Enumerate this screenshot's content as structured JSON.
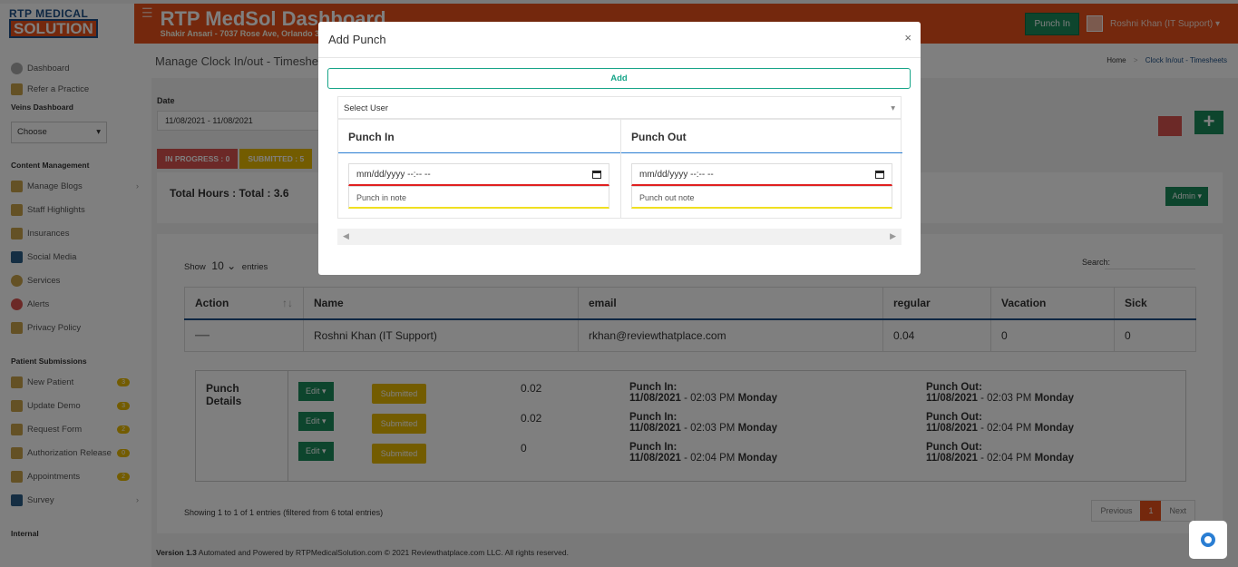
{
  "app": {
    "logo_line1": "RTP MEDICAL",
    "logo_line2": "SOLUTION",
    "title": "RTP MedSol Dashboard",
    "subtitle": "Shakir Ansari - 7037 Rose Ave, Orlando 3",
    "punch_in_button": "Punch In",
    "user_name": "Roshni Khan (IT Support)"
  },
  "sidebar": {
    "top_items": [
      {
        "label": "Dashboard",
        "icon": "clock-icon"
      },
      {
        "label": "Refer a Practice",
        "icon": "refer-icon"
      }
    ],
    "veins_heading": "Veins Dashboard",
    "choose_select": "Choose",
    "content_heading": "Content Management",
    "content_items": [
      {
        "label": "Manage Blogs",
        "icon": "blog-icon",
        "chevron": true
      },
      {
        "label": "Staff Highlights",
        "icon": "staff-icon"
      },
      {
        "label": "Insurances",
        "icon": "insurance-icon"
      },
      {
        "label": "Social Media",
        "icon": "social-icon"
      },
      {
        "label": "Services",
        "icon": "services-icon"
      },
      {
        "label": "Alerts",
        "icon": "alert-icon"
      },
      {
        "label": "Privacy Policy",
        "icon": "privacy-icon"
      }
    ],
    "patient_heading": "Patient Submissions",
    "patient_items": [
      {
        "label": "New Patient",
        "icon": "patient-icon",
        "badge": "3"
      },
      {
        "label": "Update Demo",
        "icon": "update-icon",
        "badge": "3"
      },
      {
        "label": "Request Form",
        "icon": "request-icon",
        "badge": "2"
      },
      {
        "label": "Authorization Release",
        "icon": "auth-icon",
        "badge": "0"
      },
      {
        "label": "Appointments",
        "icon": "calendar-icon",
        "badge": "2"
      },
      {
        "label": "Survey",
        "icon": "survey-icon",
        "chevron": true
      }
    ],
    "internal_heading": "Internal"
  },
  "page": {
    "heading": "Manage Clock In/out - Timeshe",
    "breadcrumb_home": "Home",
    "breadcrumb_sep": ">",
    "breadcrumb_active": "Clock In/out - Timesheets",
    "date_label": "Date",
    "date_value": "11/08/2021 - 11/08/2021",
    "status_pills": [
      {
        "label": "IN PROGRESS : 0",
        "color": "#d9534f"
      },
      {
        "label": "SUBMITTED : 5",
        "color": "#e6b800"
      }
    ],
    "total_hours": "Total Hours : Total : 3.6",
    "admin_button": "Admin",
    "plus_button": "+"
  },
  "table": {
    "show_label": "Show",
    "show_value": "10",
    "entries_label": "entries",
    "search_label": "Search:",
    "headers": [
      "Action",
      "Name",
      "email",
      "regular",
      "Vacation",
      "Sick"
    ],
    "sort_glyph": "↑↓",
    "row": {
      "action": "—",
      "name": "Roshni Khan (IT Support)",
      "email": "rkhan@reviewthatplace.com",
      "regular": "0.04",
      "vacation": "0",
      "sick": "0"
    },
    "punch_details_label": "Punch Details",
    "punches": [
      {
        "edit": "Edit",
        "status": "Submitted",
        "hours": "0.02",
        "in_label": "Punch In:",
        "in_date": "11/08/2021",
        "in_time": " - 02:03 PM ",
        "in_day": "Monday",
        "out_label": "Punch Out:",
        "out_date": "11/08/2021",
        "out_time": " - 02:03 PM ",
        "out_day": "Monday"
      },
      {
        "edit": "Edit",
        "status": "Submitted",
        "hours": "0.02",
        "in_label": "Punch In:",
        "in_date": "11/08/2021",
        "in_time": " - 02:03 PM ",
        "in_day": "Monday",
        "out_label": "Punch Out:",
        "out_date": "11/08/2021",
        "out_time": " - 02:04 PM ",
        "out_day": "Monday"
      },
      {
        "edit": "Edit",
        "status": "Submitted",
        "hours": "0",
        "in_label": "Punch In:",
        "in_date": "11/08/2021",
        "in_time": " - 02:04 PM ",
        "in_day": "Monday",
        "out_label": "Punch Out:",
        "out_date": "11/08/2021",
        "out_time": " - 02:04 PM ",
        "out_day": "Monday"
      }
    ],
    "showing": "Showing 1 to 1 of 1 entries (filtered from 6 total entries)",
    "pager": {
      "previous": "Previous",
      "current": "1",
      "next": "Next"
    }
  },
  "footer": {
    "version": "Version 1.3",
    "text": "  Automated and Powered by RTPMedicalSolution.com © 2021 Reviewthatplace.com LLC. All rights reserved."
  },
  "modal": {
    "title": "Add Punch",
    "close": "×",
    "add_button": "Add",
    "select_user": "Select User",
    "punch_in_header": "Punch In",
    "punch_out_header": "Punch Out",
    "datetime_placeholder": "mm/dd/yyyy --:-- --",
    "punch_in_note_placeholder": "Punch in note",
    "punch_out_note_placeholder": "Punch out note"
  },
  "colors": {
    "brand": "#e8501a",
    "primary_green": "#1a8a5a",
    "accent_teal": "#18a589",
    "submitted_yellow": "#e6b800"
  }
}
